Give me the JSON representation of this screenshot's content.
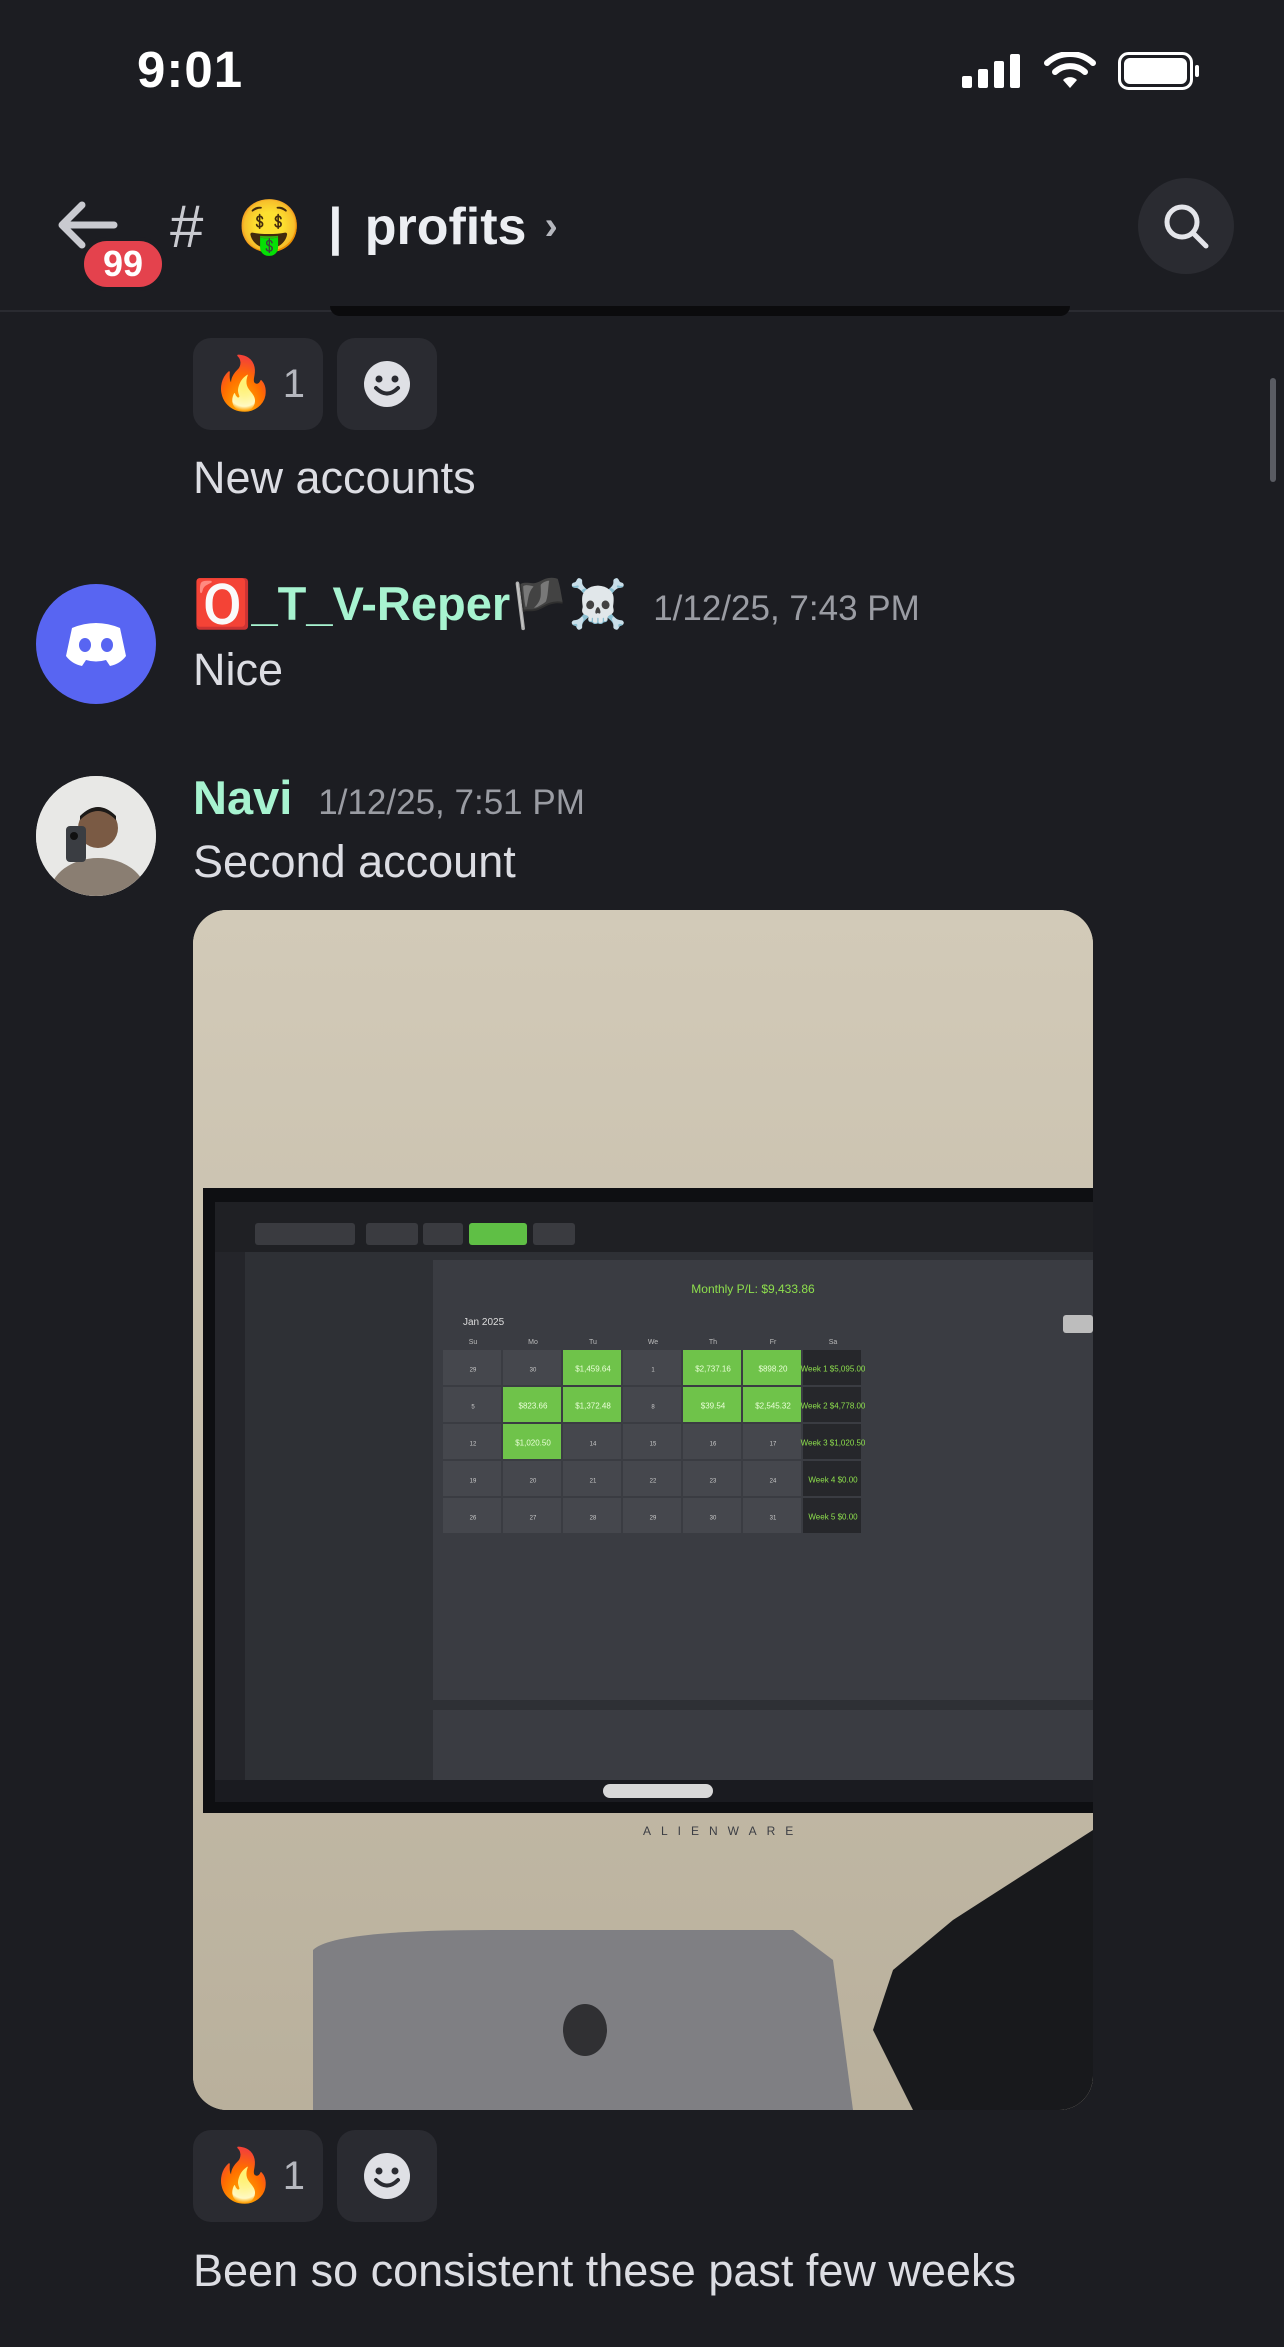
{
  "status": {
    "time": "9:01"
  },
  "header": {
    "badge_count": "99",
    "hash": "#",
    "emoji": "🤑",
    "separator": "|",
    "channel_name": "profits",
    "chevron": "›"
  },
  "messages": [
    {
      "reactions": [
        {
          "emoji": "🔥",
          "count": "1"
        }
      ],
      "text": "New accounts"
    },
    {
      "author": "🅾️_T_V-Reper🏴☠️",
      "timestamp": "1/12/25, 7:43 PM",
      "text": "Nice"
    },
    {
      "author": "Navi",
      "timestamp": "1/12/25, 7:51 PM",
      "text": "Second account",
      "reactions": [
        {
          "emoji": "🔥",
          "count": "1"
        }
      ]
    },
    {
      "text": "Been so consistent these past few weeks"
    }
  ],
  "screen_in_photo": {
    "title": "Monthly P/L: $9,433.86",
    "month": "Jan 2025",
    "today_label": "Today",
    "brand": "ALIENWARE",
    "days": [
      "Su",
      "Mo",
      "Tu",
      "We",
      "Th",
      "Fr",
      "Sa"
    ],
    "cells": [
      [
        "29",
        "30",
        "$1,459.64",
        "1",
        "$2,737.16",
        "$898.20",
        "Week 1 $5,095.00"
      ],
      [
        "5",
        "$823.66",
        "$1,372.48",
        "8",
        "$39.54",
        "$2,545.32",
        "Week 2 $4,778.00"
      ],
      [
        "12",
        "$1,020.50",
        "14",
        "15",
        "16",
        "17",
        "Week 3 $1,020.50"
      ],
      [
        "19",
        "20",
        "21",
        "22",
        "23",
        "24",
        "Week 4 $0.00"
      ],
      [
        "26",
        "27",
        "28",
        "29",
        "30",
        "31",
        "Week 5 $0.00"
      ]
    ]
  },
  "colors": {
    "background": "#1c1d22",
    "username_color": "#a7f3d0",
    "badge": "#e4424d",
    "discord_blurple": "#5865f2"
  }
}
